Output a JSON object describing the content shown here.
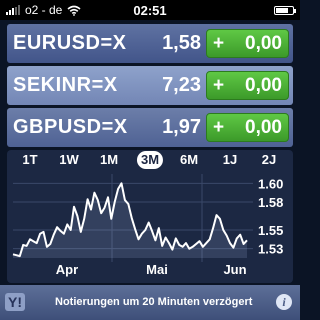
{
  "status_bar": {
    "carrier": "o2 - de",
    "time": "02:51",
    "wifi_icon": "wifi-icon",
    "battery_icon": "battery-icon"
  },
  "quotes": [
    {
      "symbol": "EURUSD=X",
      "price": "1,58",
      "change_sign": "+",
      "change": "0,00"
    },
    {
      "symbol": "SEKINR=X",
      "price": "7,23",
      "change_sign": "+",
      "change": "0,00"
    },
    {
      "symbol": "GBPUSD=X",
      "price": "1,97",
      "change_sign": "+",
      "change": "0,00"
    }
  ],
  "colors": {
    "change_positive": "#4cb535",
    "chart_line": "#ffffff",
    "chart_background": "#1c2843"
  },
  "range_tabs": [
    "1T",
    "1W",
    "1M",
    "3M",
    "6M",
    "1J",
    "2J"
  ],
  "active_range": "3M",
  "chart_data": {
    "type": "line",
    "x_labels": [
      "Apr",
      "Mai",
      "Jun"
    ],
    "y_ticks": [
      "1.60",
      "1.58",
      "1.55",
      "1.53"
    ],
    "ylim": [
      1.52,
      1.61
    ],
    "values": [
      1.524,
      1.523,
      1.522,
      1.534,
      1.533,
      1.54,
      1.538,
      1.536,
      1.546,
      1.548,
      1.532,
      1.535,
      1.545,
      1.553,
      1.549,
      1.546,
      1.556,
      1.55,
      1.575,
      1.565,
      1.548,
      1.562,
      1.583,
      1.572,
      1.59,
      1.582,
      1.568,
      1.574,
      1.585,
      1.562,
      1.58,
      1.594,
      1.6,
      1.582,
      1.578,
      1.563,
      1.551,
      1.54,
      1.546,
      1.55,
      1.558,
      1.549,
      1.539,
      1.552,
      1.533,
      1.542,
      1.536,
      1.529,
      1.541,
      1.534,
      1.532,
      1.536,
      1.53,
      1.532,
      1.535,
      1.538,
      1.532,
      1.536,
      1.54,
      1.552,
      1.566,
      1.562,
      1.55,
      1.544,
      1.536,
      1.531,
      1.541,
      1.545,
      1.535,
      1.539
    ]
  },
  "footer": {
    "yahoo_icon": "Y!",
    "text": "Notierungen um 20 Minuten verzögert",
    "info_icon": "i"
  }
}
